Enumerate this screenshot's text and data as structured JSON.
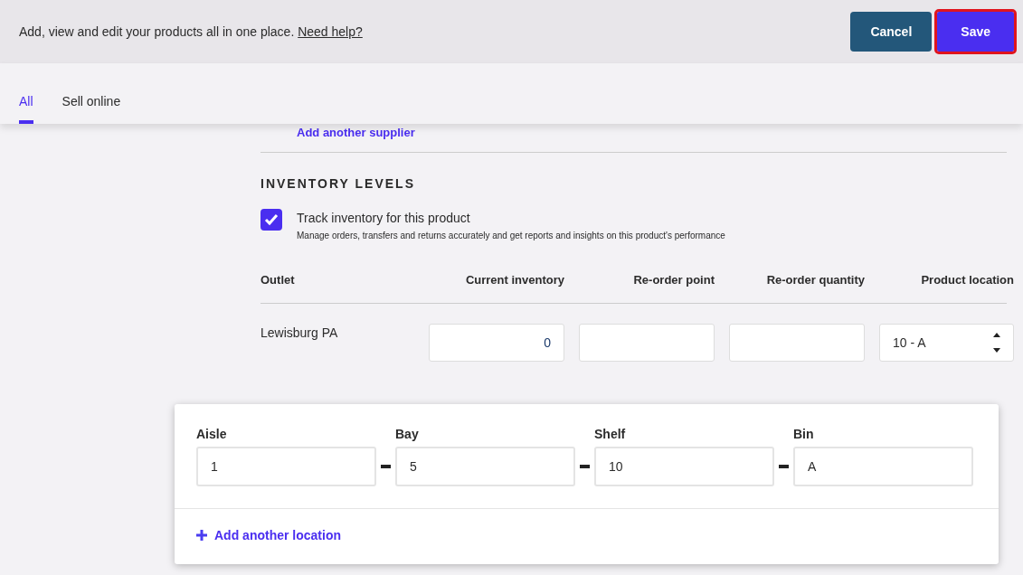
{
  "header": {
    "description": "Add, view and edit your products all in one place.",
    "help_link": "Need help?",
    "buttons": [
      {
        "label": "Cancel",
        "kind": "secondary"
      },
      {
        "label": "Save",
        "kind": "primary"
      }
    ]
  },
  "tabs": [
    {
      "label": "All",
      "selected": true
    },
    {
      "label": "Sell online",
      "selected": false
    }
  ],
  "supplier_link": "Add another supplier",
  "inventory": {
    "title": "INVENTORY LEVELS",
    "track": {
      "label": "Track inventory for this product",
      "hint": "Manage orders, transfers and returns accurately and get reports and insights on this product's performance",
      "checked": true
    },
    "columns": [
      "Outlet",
      "Current inventory",
      "Re-order point",
      "Re-order quantity",
      "Product location"
    ],
    "rows": [
      {
        "outlet": "Lewisburg PA",
        "current_inventory": "0",
        "reorder_point": "",
        "reorder_quantity": "",
        "location": "10 - A"
      }
    ]
  },
  "location_popover": {
    "fields": [
      {
        "label": "Aisle",
        "value": "1"
      },
      {
        "label": "Bay",
        "value": "5"
      },
      {
        "label": "Shelf",
        "value": "10"
      },
      {
        "label": "Bin",
        "value": "A"
      }
    ],
    "add_link": "Add another location"
  }
}
